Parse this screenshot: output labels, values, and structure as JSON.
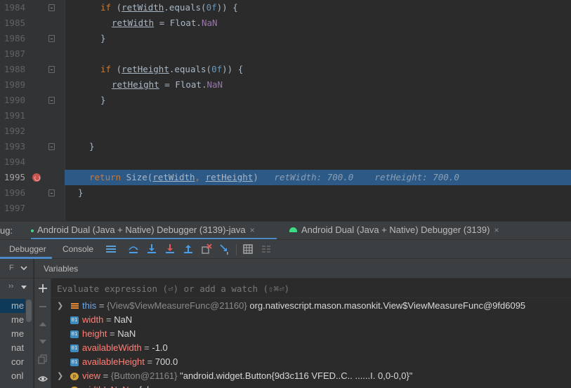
{
  "editor": {
    "lines": [
      {
        "num": "1984",
        "indent": 143,
        "parts": [
          [
            "kw",
            "if"
          ],
          [
            "p",
            " ("
          ],
          [
            "fu",
            "retWidth"
          ],
          [
            "p",
            ".equals("
          ],
          [
            "n",
            "0f"
          ],
          [
            "p",
            ")) {"
          ]
        ]
      },
      {
        "num": "1985",
        "indent": 159,
        "parts": [
          [
            "fu",
            "retWidth"
          ],
          [
            "p",
            " = Float."
          ],
          [
            "f",
            "NaN"
          ]
        ]
      },
      {
        "num": "1986",
        "indent": 143,
        "parts": [
          [
            "p",
            "}"
          ]
        ]
      },
      {
        "num": "1987",
        "indent": 143,
        "parts": []
      },
      {
        "num": "1988",
        "indent": 143,
        "parts": [
          [
            "kw",
            "if"
          ],
          [
            "p",
            " ("
          ],
          [
            "fu",
            "retHeight"
          ],
          [
            "p",
            ".equals("
          ],
          [
            "n",
            "0f"
          ],
          [
            "p",
            ")) {"
          ]
        ]
      },
      {
        "num": "1989",
        "indent": 159,
        "parts": [
          [
            "fu",
            "retHeight"
          ],
          [
            "p",
            " = Float."
          ],
          [
            "f",
            "NaN"
          ]
        ]
      },
      {
        "num": "1990",
        "indent": 143,
        "parts": [
          [
            "p",
            "}"
          ]
        ]
      },
      {
        "num": "1991",
        "indent": 143,
        "parts": []
      },
      {
        "num": "1992",
        "indent": 143,
        "parts": []
      },
      {
        "num": "1993",
        "indent": 127,
        "parts": [
          [
            "p",
            "}"
          ]
        ]
      },
      {
        "num": "1994",
        "indent": 127,
        "parts": []
      },
      {
        "num": "1995",
        "indent": 127,
        "parts": [
          [
            "kw",
            "return"
          ],
          [
            "p",
            " Size("
          ],
          [
            "u",
            "retWidth"
          ],
          [
            "kw",
            ", "
          ],
          [
            "u",
            "retHeight"
          ],
          [
            "p",
            ")"
          ]
        ],
        "current": true,
        "inline": [
          "retWidth: 700.0",
          "retHeight: 700.0"
        ]
      },
      {
        "num": "1996",
        "indent": 111,
        "parts": [
          [
            "p",
            "}"
          ]
        ]
      },
      {
        "num": "1997",
        "indent": 111,
        "parts": []
      }
    ]
  },
  "debug_panel": {
    "label": "ug:",
    "tabs": [
      {
        "title": "Android Dual (Java + Native) Debugger (3139)-java",
        "active": true
      },
      {
        "title": "Android Dual (Java + Native) Debugger (3139)",
        "active": false
      }
    ],
    "close_glyph": "×"
  },
  "toolbar": {
    "debugger_tab": "Debugger",
    "console_tab": "Console"
  },
  "frames": {
    "filter_label": "F",
    "items": [
      "me",
      "me",
      "me",
      "nat",
      "cor",
      "onl"
    ]
  },
  "variables": {
    "header": "Variables",
    "eval_placeholder": "Evaluate expression (⏎) or add a watch (⇧⌘⏎)",
    "rows": [
      {
        "icon": "arr",
        "expandable": true,
        "name": "this",
        "name_class": "this",
        "type": "{View$ViewMeasureFunc@21160}",
        "value": "org.nativescript.mason.masonkit.View$ViewMeasureFunc@9fd6095"
      },
      {
        "icon": "field",
        "icon_text": "01",
        "expandable": false,
        "name": "width",
        "type": "",
        "value": "NaN"
      },
      {
        "icon": "field",
        "icon_text": "01",
        "expandable": false,
        "name": "height",
        "type": "",
        "value": "NaN"
      },
      {
        "icon": "field",
        "icon_text": "01",
        "expandable": false,
        "name": "availableWidth",
        "type": "",
        "value": "-1.0"
      },
      {
        "icon": "field",
        "icon_text": "01",
        "expandable": false,
        "name": "availableHeight",
        "type": "",
        "value": "700.0"
      },
      {
        "icon": "obj",
        "icon_text": "p",
        "expandable": true,
        "name": "view",
        "type": "{Button@21161}",
        "value": "\"android.widget.Button{9d3c116 VFED..C.. ......I. 0,0-0,0}\""
      },
      {
        "icon": "obj",
        "icon_text": "p",
        "expandable": false,
        "name": "widthIsNaN",
        "type": "",
        "value": "false"
      }
    ]
  },
  "colors": {
    "editor_bg": "#2b2b2b",
    "current_line": "#2d5986",
    "breakpoint": "#c75450",
    "keyword": "#cc7832",
    "field_purple": "#9876aa",
    "number": "#6897bb",
    "var_name": "#ff8078",
    "active_tab_underline": "#4a88c7"
  }
}
